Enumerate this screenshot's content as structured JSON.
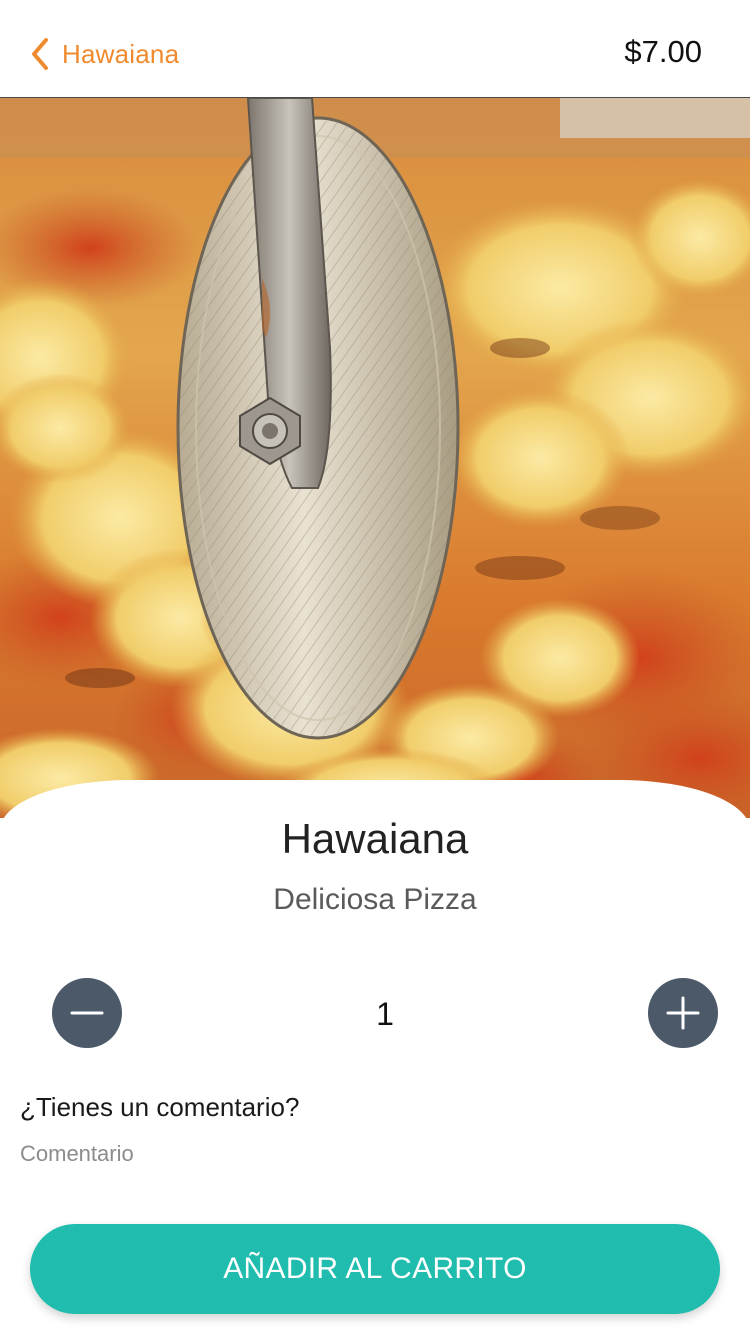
{
  "header": {
    "back_label": "Hawaiana",
    "price": "$7.00"
  },
  "hero": {
    "image_icon": "pizza-cutter-photo"
  },
  "product": {
    "title": "Hawaiana",
    "subtitle": "Deliciosa Pizza"
  },
  "quantity": {
    "value": "1",
    "minus_icon": "minus-icon",
    "plus_icon": "plus-icon"
  },
  "comment": {
    "label": "¿Tienes un comentario?",
    "placeholder": "Comentario",
    "value": ""
  },
  "actions": {
    "add_to_cart_label": "AÑADIR AL CARRITO"
  },
  "colors": {
    "accent_orange": "#ef8a2e",
    "button_teal": "#20bdaf",
    "stepper_slate": "#4b5968"
  }
}
